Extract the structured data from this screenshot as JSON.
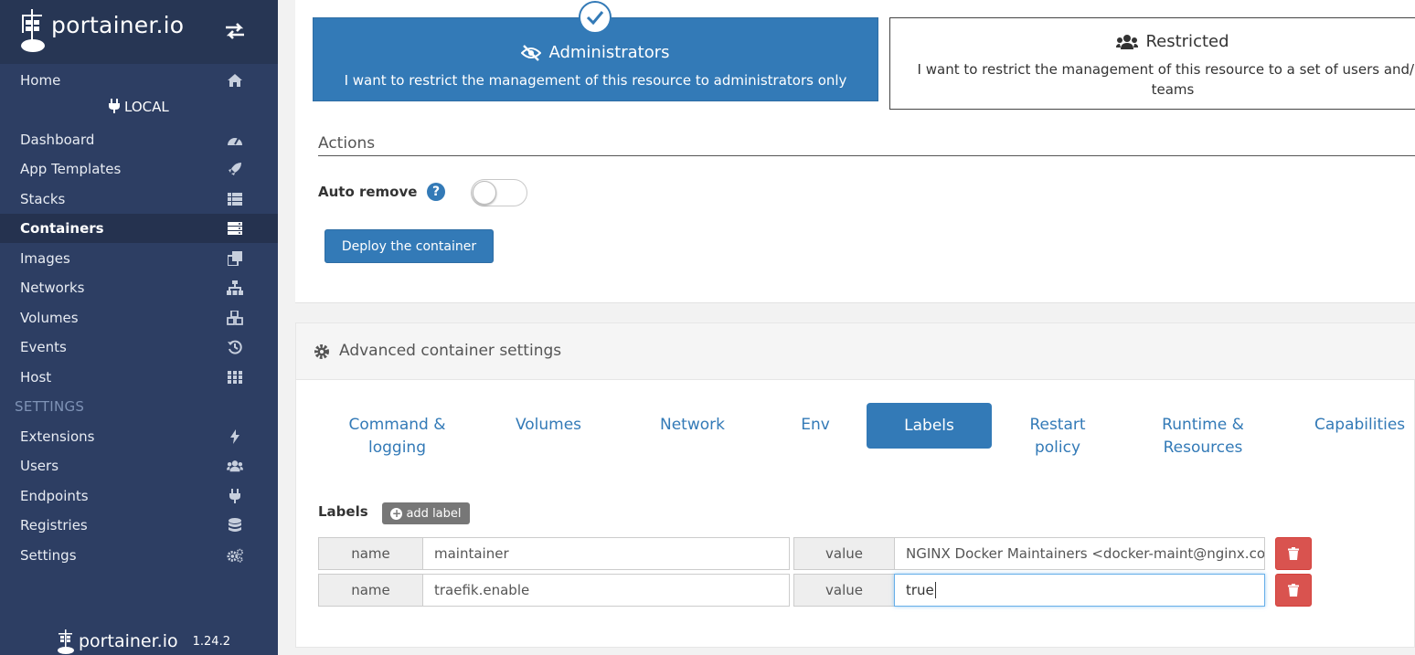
{
  "brand": {
    "name": "portainer.io",
    "version": "1.24.2"
  },
  "sidebar": {
    "home": "Home",
    "endpoint": "LOCAL",
    "items": [
      {
        "label": "Dashboard",
        "icon": "tachometer-icon"
      },
      {
        "label": "App Templates",
        "icon": "rocket-icon"
      },
      {
        "label": "Stacks",
        "icon": "th-list-icon"
      },
      {
        "label": "Containers",
        "icon": "server-icon"
      },
      {
        "label": "Images",
        "icon": "clone-icon"
      },
      {
        "label": "Networks",
        "icon": "sitemap-icon"
      },
      {
        "label": "Volumes",
        "icon": "cubes-icon"
      },
      {
        "label": "Events",
        "icon": "history-icon"
      },
      {
        "label": "Host",
        "icon": "th-icon"
      }
    ],
    "settings_section": "SETTINGS",
    "settings_items": [
      {
        "label": "Extensions",
        "icon": "bolt-icon"
      },
      {
        "label": "Users",
        "icon": "users-icon"
      },
      {
        "label": "Endpoints",
        "icon": "plug-icon"
      },
      {
        "label": "Registries",
        "icon": "database-icon"
      },
      {
        "label": "Settings",
        "icon": "cogs-icon"
      }
    ],
    "active": "Containers"
  },
  "access_control": {
    "admin_title": "Administrators",
    "admin_desc": "I want to restrict the management of this resource to administrators only",
    "restricted_title": "Restricted",
    "restricted_desc": "I want to restrict the management of this resource to a set of users and/or teams",
    "selected": "Administrators"
  },
  "actions": {
    "title": "Actions",
    "auto_remove_label": "Auto remove",
    "auto_remove_enabled": false,
    "deploy_button": "Deploy the container"
  },
  "advanced": {
    "title": "Advanced container settings",
    "tabs": [
      {
        "label": "Command & logging"
      },
      {
        "label": "Volumes"
      },
      {
        "label": "Network"
      },
      {
        "label": "Env"
      },
      {
        "label": "Labels"
      },
      {
        "label": "Restart policy"
      },
      {
        "label": "Runtime & Resources"
      },
      {
        "label": "Capabilities"
      }
    ],
    "active_tab": "Labels"
  },
  "labels": {
    "title": "Labels",
    "add_button": "add label",
    "name_addon": "name",
    "value_addon": "value",
    "rows": [
      {
        "name": "maintainer",
        "value": "NGINX Docker Maintainers <docker-maint@nginx.com>"
      },
      {
        "name": "traefik.enable",
        "value": "true"
      }
    ]
  },
  "colors": {
    "sidebar_bg": "#2d3e63",
    "primary": "#337ab7",
    "danger": "#d9534f"
  }
}
